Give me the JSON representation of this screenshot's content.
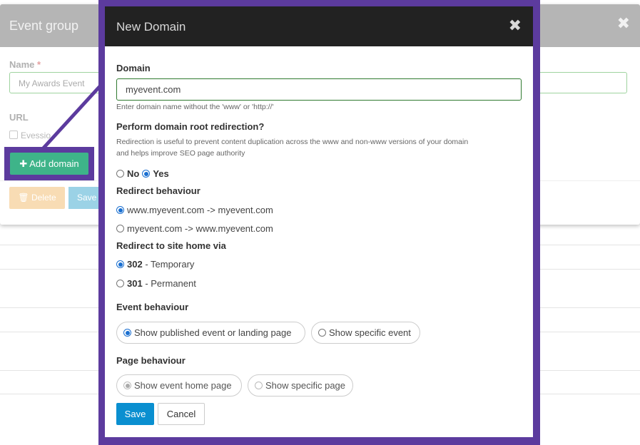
{
  "background": {
    "modal_title": "Event group",
    "name_label": "Name",
    "required_mark": "*",
    "name_value": "My Awards Event",
    "url_label": "URL",
    "checkbox_label": "Evessio",
    "add_domain_label": "Add domain",
    "delete_label": "Delete",
    "save_label": "Save"
  },
  "dialog": {
    "title": "New Domain",
    "domain": {
      "label": "Domain",
      "value": "myevent.com",
      "help": "Enter domain name without the 'www' or 'http://'"
    },
    "root_redirect": {
      "label": "Perform domain root redirection?",
      "help_line1": "Redirection is useful to prevent content duplication across the www and non-www versions of your domain",
      "help_line2": "and helps improve SEO page authority",
      "no_label": "No",
      "yes_label": "Yes",
      "selected": "Yes"
    },
    "redirect_behaviour": {
      "label": "Redirect behaviour",
      "option1": "www.myevent.com -> myevent.com",
      "option2": "myevent.com -> www.myevent.com",
      "selected": "option1"
    },
    "redirect_home": {
      "label": "Redirect to site home via",
      "option1_code": "302",
      "option1_text": " - Temporary",
      "option2_code": "301",
      "option2_text": " - Permanent",
      "selected": "302"
    },
    "event_behaviour": {
      "label": "Event behaviour",
      "option1": "Show published event or landing page",
      "option2": "Show specific event",
      "selected": "option1"
    },
    "page_behaviour": {
      "label": "Page behaviour",
      "option1": "Show event home page",
      "option2": "Show specific page",
      "selected": "option1"
    },
    "save_label": "Save",
    "cancel_label": "Cancel"
  },
  "colors": {
    "highlight": "#5c3b9e",
    "add_button": "#3eb489",
    "save_button": "#0a8fd0",
    "header_dark": "#222222"
  }
}
